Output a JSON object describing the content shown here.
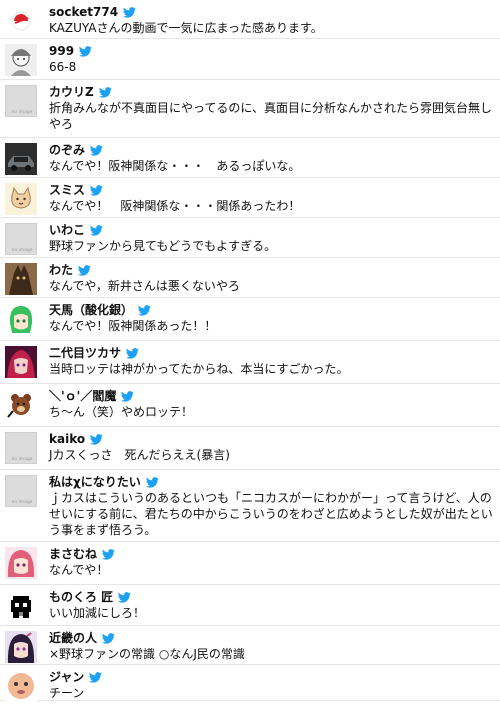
{
  "colors": {
    "twitter_blue": "#1DA1F2",
    "divider": "#e6e6e6",
    "text": "#111111"
  },
  "icons": {
    "verified_bird": "twitter-bird-icon",
    "placeholder": "no-image-avatar"
  },
  "no_image_text": "no image",
  "tweets": [
    {
      "username": "socket774",
      "text": "KAZUYAさんの動画で一気に広まった感あります。",
      "avatar": "red-logo-avatar"
    },
    {
      "username": "999",
      "text": "66-8",
      "avatar": "sketch-avatar"
    },
    {
      "username": "カウリZ",
      "text": "折角みんなが不真面目にやってるのに、真面目に分析なんかされたら雰囲気台無しやろ",
      "avatar": "no-image-avatar"
    },
    {
      "username": "のぞみ",
      "text": "なんでや！阪神関係な・・・　あるっぽいな。",
      "avatar": "car-avatar"
    },
    {
      "username": "スミス",
      "text": "なんでや！　阪神関係な・・・関係あったわ！",
      "avatar": "cat-avatar"
    },
    {
      "username": "いわこ",
      "text": "野球ファンから見てもどうでもよすぎる。",
      "avatar": "no-image-avatar"
    },
    {
      "username": "わた",
      "text": "なんでや，新井さんは悪くないやろ",
      "avatar": "monster-avatar"
    },
    {
      "username": "天馬（酸化銀）",
      "text": "なんでや！阪神関係あった！！",
      "avatar": "green-hair-avatar"
    },
    {
      "username": "二代目ツカサ",
      "text": "当時ロッテは神がかってたからね、本当にすごかった。",
      "avatar": "purple-character-avatar"
    },
    {
      "username": "＼'ｏ'／閻魔",
      "text": "ち～ん（笑）やめロッテ！",
      "avatar": "bear-avatar"
    },
    {
      "username": "kaiko",
      "text": "Jカスくっさ　死んだらええ(暴言)",
      "avatar": "no-image-avatar"
    },
    {
      "username": "私はχになりたい",
      "text": "ｊカスはこういうのあるといつも「ニコカスがーにわかがー」って言うけど、人のせいにする前に、君たちの中からこういうのをわざと広めようとした奴が出たという事をまず悟ろう。",
      "avatar": "no-image-avatar"
    },
    {
      "username": "まさむね",
      "text": "なんでや！",
      "avatar": "pink-hair-avatar"
    },
    {
      "username": "ものくろ 匠",
      "text": "いい加減にしろ！",
      "avatar": "pixel-avatar"
    },
    {
      "username": "近畿の人",
      "text": "×野球ファンの常識 ○なんJ民の常識",
      "avatar": "dark-hair-avatar"
    },
    {
      "username": "ジャン",
      "text": "チーン",
      "avatar": "baby-face-avatar"
    }
  ]
}
